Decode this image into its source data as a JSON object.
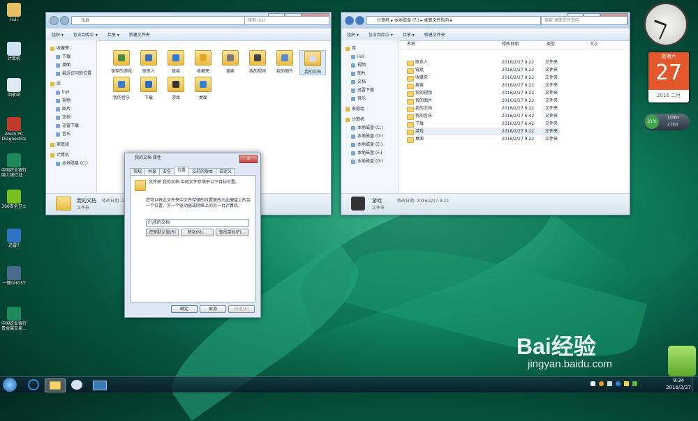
{
  "desktop": {
    "icons": [
      {
        "label": "liuli",
        "color": "#e7c061"
      },
      {
        "label": "计算机",
        "color": "#cfe3f7"
      },
      {
        "label": "回收站",
        "color": "#dfe9f3"
      },
      {
        "label": "ASUS PC Diagnostics",
        "color": "#c0392b"
      },
      {
        "label": "中国农业银行 网上银行证...",
        "color": "#1c8a5b"
      },
      {
        "label": "360安全卫士",
        "color": "#79c021"
      },
      {
        "label": "迅雷7",
        "color": "#2f73c4"
      },
      {
        "label": "一键GHOST",
        "color": "#4a6b8d"
      },
      {
        "label": "中国农业银行 贵金属交易...",
        "color": "#1c8a5b"
      }
    ]
  },
  "win1": {
    "address": "liuli",
    "search_placeholder": "搜索 liuli",
    "toolbar": [
      "组织 ▾",
      "包含到库中 ▾",
      "共享 ▾",
      "新建文件夹"
    ],
    "nav": [
      "收藏夹",
      "下载",
      "桌面",
      "最近访问的位置",
      "库",
      "liuli",
      "视频",
      "图片",
      "文档",
      "迅雷下载",
      "音乐",
      "家庭组",
      "计算机",
      "本地磁盘 (C:)"
    ],
    "items": [
      {
        "label": "保存的游戏",
        "color": "#4a8b3b"
      },
      {
        "label": "联系人",
        "color": "#3b6fb6"
      },
      {
        "label": "链接",
        "color": "#2c7bd1"
      },
      {
        "label": "收藏夹",
        "color": "#e5a52b"
      },
      {
        "label": "搜索",
        "color": "#7a7a7a"
      },
      {
        "label": "我的视频",
        "color": "#444"
      },
      {
        "label": "我的图片",
        "color": "#5a8ccf"
      },
      {
        "label": "我的文档",
        "color": "#d6d9de"
      },
      {
        "label": "我的音乐",
        "color": "#3a7fd0"
      },
      {
        "label": "下载",
        "color": "#2d6bbf"
      },
      {
        "label": "游戏",
        "color": "#333"
      },
      {
        "label": "桌面",
        "color": "#2f82d2"
      }
    ],
    "details": {
      "name": "我的文档",
      "modified": "修改日期: 2016/2/27 9:22",
      "type": "文件夹"
    }
  },
  "win2": {
    "address": "计算机 ▸ 本地磁盘 (F:) ▸ 桌面文件指向 ▸",
    "search_placeholder": "搜索 桌面文件指向",
    "toolbar": [
      "组织 ▾",
      "包含到库中 ▾",
      "共享 ▾",
      "新建文件夹"
    ],
    "nav": [
      "库",
      "liuli",
      "视频",
      "图片",
      "文档",
      "迅雷下载",
      "音乐",
      "家庭组",
      "计算机",
      "本地磁盘 (C:)",
      "本地磁盘 (D:)",
      "本地磁盘 (E:)",
      "本地磁盘 (F:)",
      "本地磁盘 (G:)"
    ],
    "headers": {
      "name": "名称",
      "date": "修改日期",
      "type": "类型",
      "size": "大小"
    },
    "rows": [
      {
        "name": "联系人",
        "date": "2016/2/27 9:22",
        "type": "文件夹"
      },
      {
        "name": "链接",
        "date": "2016/2/27 9:22",
        "type": "文件夹"
      },
      {
        "name": "收藏夹",
        "date": "2016/2/27 9:22",
        "type": "文件夹"
      },
      {
        "name": "搜索",
        "date": "2016/2/27 9:22",
        "type": "文件夹"
      },
      {
        "name": "我的视频",
        "date": "2016/2/27 9:22",
        "type": "文件夹"
      },
      {
        "name": "我的图片",
        "date": "2016/2/27 9:22",
        "type": "文件夹"
      },
      {
        "name": "我的文档",
        "date": "2016/2/27 9:22",
        "type": "文件夹"
      },
      {
        "name": "我的音乐",
        "date": "2016/2/27 6:42",
        "type": "文件夹"
      },
      {
        "name": "下载",
        "date": "2016/2/27 6:42",
        "type": "文件夹"
      },
      {
        "name": "游戏",
        "date": "2016/2/27 9:22",
        "type": "文件夹"
      },
      {
        "name": "桌面",
        "date": "2016/2/27 9:22",
        "type": "文件夹"
      }
    ],
    "details": {
      "name": "游戏",
      "modified": "修改日期: 2016/2/27 9:22",
      "type": "文件夹"
    }
  },
  "dialog": {
    "title": "我的文档 属性",
    "tabs": [
      "常规",
      "共享",
      "安全",
      "位置",
      "以前的版本",
      "自定义"
    ],
    "info": "文件夹 我的文档 中的文件存储于以下目标位置。",
    "desc": "您可以将此文件夹中文件存储的位置更改为此硬盘上的另一个位置、另一个驱动器或网络上的另一台计算机。",
    "path": "F:\\我的文档",
    "restore": "还原默认值(R)",
    "move": "移动(M)...",
    "find": "查找目标(F)...",
    "ok": "确定",
    "cancel": "取消",
    "apply": "应用(A)"
  },
  "gadgets": {
    "weekday": "星期六",
    "day": "27",
    "yearmonth": "2016 二月",
    "cpu": "21%",
    "up": "120K/s",
    "down": "2.1K/s"
  },
  "watermark": {
    "brand": "Bai经验",
    "url": "jingyan.baidu.com"
  },
  "taskbar": {
    "time": "9:34",
    "date": "2016/2/27"
  }
}
